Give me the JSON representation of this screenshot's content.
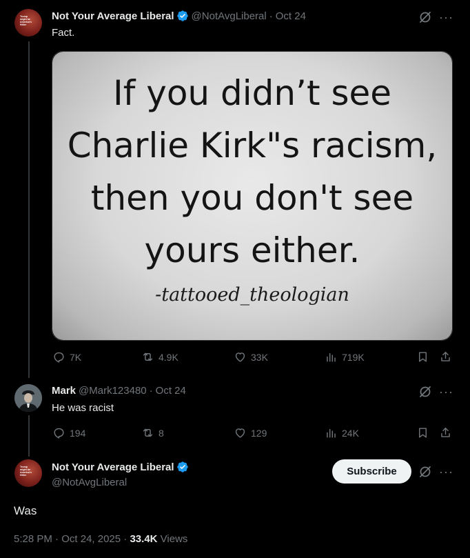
{
  "tweet1": {
    "author": "Not Your Average Liberal",
    "handle": "@NotAvgLiberal",
    "date": "Oct 24",
    "text": "Fact.",
    "image_quote_lines": [
      "If you didn’t see",
      "Charlie Kirk\"s racism,",
      "then you don't see",
      "yours either."
    ],
    "image_signature": "-tattooed_theologian",
    "avatar_text": "Trump might be America's Hitler",
    "stats": {
      "replies": "7K",
      "reposts": "4.9K",
      "likes": "33K",
      "views": "719K"
    }
  },
  "tweet2": {
    "author": "Mark",
    "handle": "@Mark123480",
    "date": "Oct 24",
    "text": "He was racist",
    "stats": {
      "replies": "194",
      "reposts": "8",
      "likes": "129",
      "views": "24K"
    }
  },
  "tweet3": {
    "author": "Not Your Average Liberal",
    "handle": "@NotAvgLiberal",
    "avatar_text": "Trump might be America's Hitler",
    "subscribe_label": "Subscribe",
    "text": "Was",
    "time": "5:28 PM",
    "full_date": "Oct 24, 2025",
    "views_count": "33.4K",
    "views_label": "Views"
  },
  "common": {
    "separator": "·",
    "more": "···"
  },
  "colors": {
    "background": "#000000",
    "text": "#e7e9ea",
    "muted": "#71767b",
    "verified": "#1d9bf0",
    "line": "#333639"
  }
}
